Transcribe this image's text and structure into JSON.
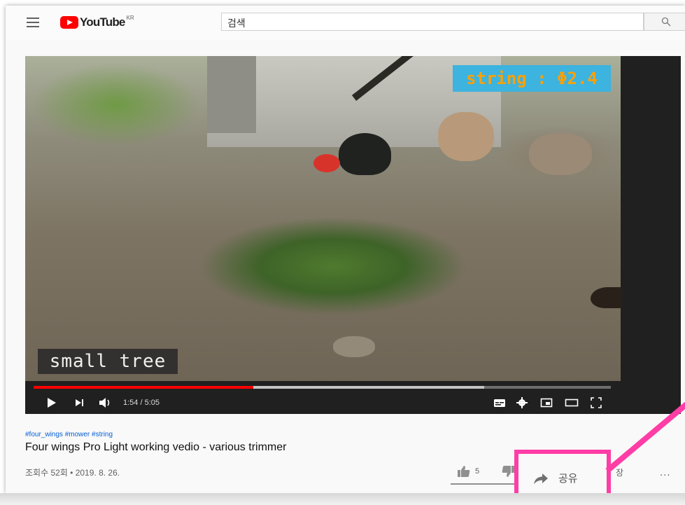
{
  "header": {
    "brand": "YouTube",
    "region": "KR",
    "search_placeholder": "검색"
  },
  "player": {
    "caption_top": "string : Φ2.4",
    "caption_bottom": "small tree",
    "time_display": "1:54 / 5:05",
    "progress_played": 0.38,
    "progress_buffered": 0.78
  },
  "video": {
    "hashtags": "#four_wings #mower #string",
    "title": "Four wings Pro Light working vedio - various trimmer",
    "meta": "조회수 52회 • 2019. 8. 26.",
    "likes": "5"
  },
  "actions": {
    "share_label": "공유",
    "save_partial": "장",
    "more_label": "..."
  },
  "colors": {
    "accent": "#ff0000",
    "highlight": "#ff3da6",
    "link": "#065fd4"
  },
  "icons": [
    "menu-icon",
    "youtube-logo-icon",
    "search-icon",
    "play-icon",
    "next-icon",
    "volume-icon",
    "subtitles-icon",
    "settings-icon",
    "miniplayer-icon",
    "theater-icon",
    "fullscreen-icon",
    "like-icon",
    "dislike-icon",
    "share-icon"
  ]
}
